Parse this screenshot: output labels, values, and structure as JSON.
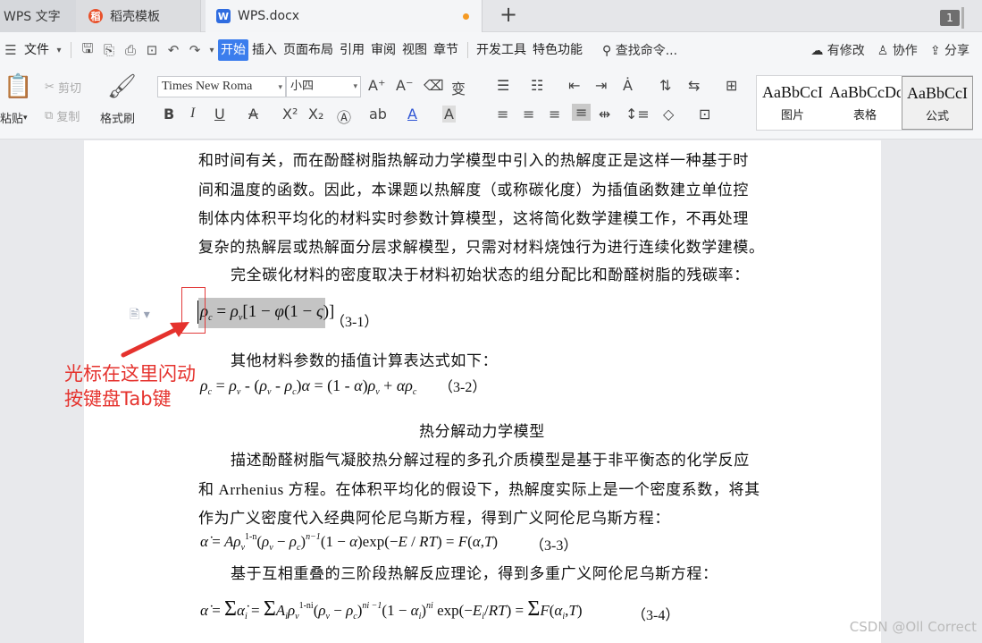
{
  "tabs": {
    "app": "WPS 文字",
    "template": "稻壳模板",
    "document": "WPS.docx",
    "new_tab": "+",
    "window_count": "1"
  },
  "menu": {
    "file": "文件",
    "items": [
      "开始",
      "插入",
      "页面布局",
      "引用",
      "审阅",
      "视图",
      "章节",
      "开发工具",
      "特色功能"
    ],
    "search": "查找命令...",
    "modified": "有修改",
    "collab": "协作",
    "share": "分享"
  },
  "ribbon": {
    "paste": "粘贴",
    "cut": "剪切",
    "copy": "复制",
    "format_painter": "格式刷",
    "font_name": "Times New Roma",
    "font_size": "小四",
    "styles": [
      {
        "sample": "AaBbCcI",
        "name": "图片"
      },
      {
        "sample": "AaBbCcDd",
        "name": "表格"
      },
      {
        "sample": "AaBbCcI",
        "name": "公式"
      }
    ]
  },
  "doc": {
    "lines": [
      "和时间有关，而在酚醛树脂热解动力学模型中引入的热解度正是这样一种基于时",
      "间和温度的函数。因此，本课题以热解度（或称碳化度）为插值函数建立单位控",
      "制体内体积平均化的材料实时参数计算模型，这将简化数学建模工作，不再处理",
      "复杂的热解层或热解面分层求解模型，只需对材料烧蚀行为进行连续化数学建模。",
      "完全碳化材料的密度取决于材料初始状态的组分配比和酚醛树脂的残碳率："
    ],
    "eq1_num": "（3-1）",
    "line_other": "其他材料参数的插值计算表达式如下：",
    "eq2_num": "（3-2）",
    "heading": "热分解动力学模型",
    "para2": [
      "描述酚醛树脂气凝胶热分解过程的多孔介质模型是基于非平衡态的化学反应",
      "和 Arrhenius 方程。在体积平均化的假设下，热解度实际上是一个密度系数，将其",
      "作为广义密度代入经典阿伦尼乌斯方程，得到广义阿伦尼乌斯方程："
    ],
    "eq3_num": "（3-3）",
    "line_multi": "基于互相重叠的三阶段热解反应理论，得到多重广义阿伦尼乌斯方程：",
    "eq4_num": "（3-4）"
  },
  "annotation": {
    "line1": "光标在这里闪动",
    "line2": "按键盘Tab键",
    "color": "#e5322d"
  },
  "watermark": "CSDN @Oll Correct"
}
